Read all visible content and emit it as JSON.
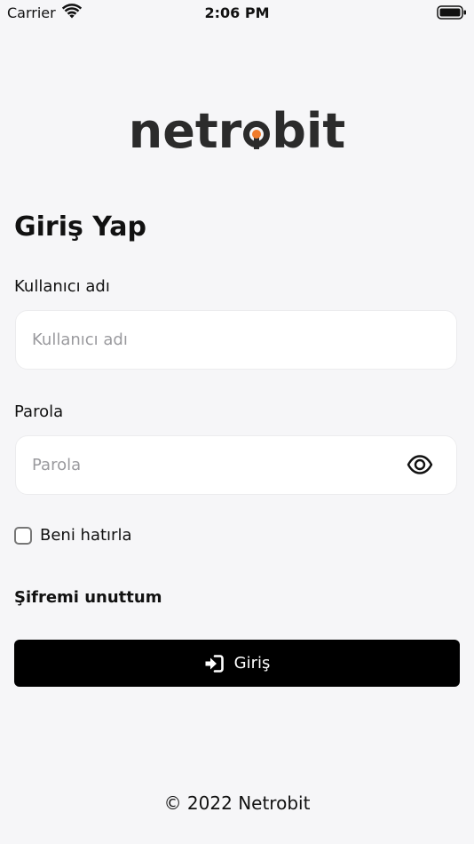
{
  "status_bar": {
    "carrier": "Carrier",
    "time": "2:06 PM"
  },
  "logo": {
    "before": "netr",
    "after": "bit",
    "accent_color": "#f07b2b"
  },
  "page_title": "Giriş Yap",
  "username": {
    "label": "Kullanıcı adı",
    "placeholder": "Kullanıcı adı",
    "value": ""
  },
  "password": {
    "label": "Parola",
    "placeholder": "Parola",
    "value": "",
    "toggle_icon": "eye-icon"
  },
  "remember_me": {
    "label": "Beni hatırla",
    "checked": false
  },
  "forgot_password": "Şifremi unuttum",
  "login_button": {
    "label": "Giriş",
    "icon": "sign-in-icon"
  },
  "footer": "© 2022 Netrobit"
}
